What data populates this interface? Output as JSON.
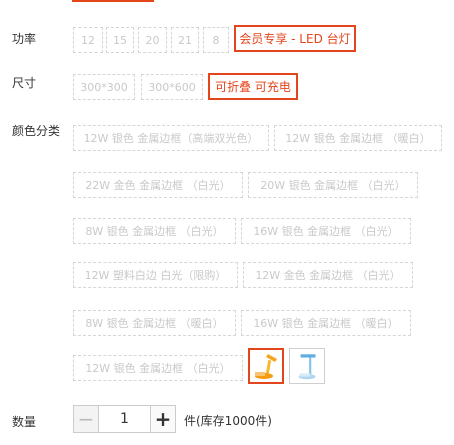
{
  "power": {
    "label": "功率",
    "options": [
      "12",
      "15",
      "20",
      "21",
      "8"
    ],
    "selected": "会员专享 - LED 台灯"
  },
  "size": {
    "label": "尺寸",
    "options": [
      "300*300",
      "300*600"
    ],
    "selected": "可折叠 可充电"
  },
  "color": {
    "label": "颜色分类",
    "options": [
      "12W 银色 金属边框（高端双光色）",
      "12W 银色 金属边框 （暖白）",
      "22W 金色 金属边框 （白光）",
      "20W 银色 金属边框 （白光）",
      "8W 银色 金属边框 （白光）",
      "16W 银色 金属边框 （白光）",
      "12W 塑料白边 白光（限购）",
      "12W 金色 金属边框 （白光）",
      "8W 银色 金属边框 （暖白）",
      "16W 银色 金属边框 （暖白）",
      "12W 银色 金属边框 （白光）"
    ],
    "image_options": [
      "orange-folding-lamp",
      "blue-white-lamp"
    ]
  },
  "quantity": {
    "label": "数量",
    "minus": "−",
    "plus": "+",
    "value": "1",
    "stock": "件(库存1000件)"
  },
  "accent_color": "#e4461c"
}
